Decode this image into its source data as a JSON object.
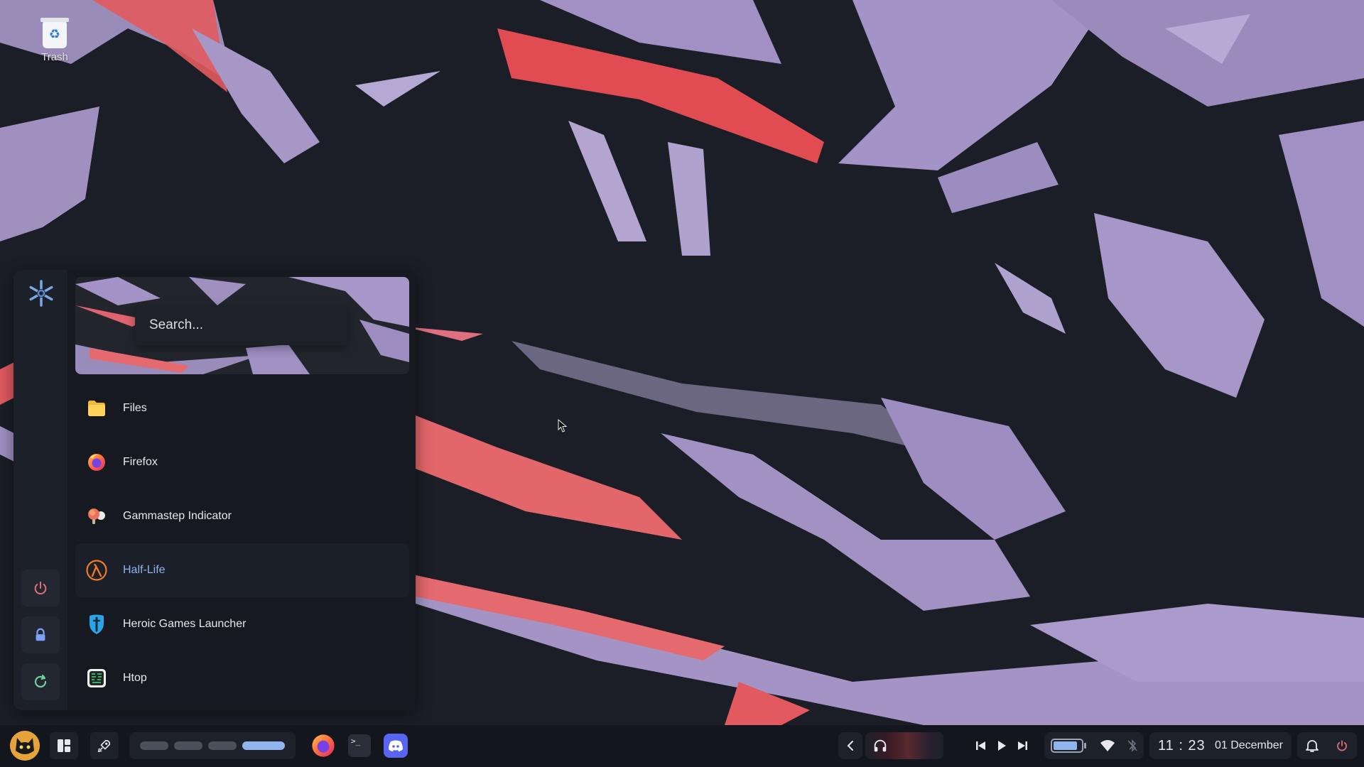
{
  "desktop": {
    "icons": [
      {
        "label": "Trash",
        "icon": "trash-icon"
      }
    ]
  },
  "launcher": {
    "logo": "nixos-snowflake-icon",
    "search": {
      "placeholder": "Search...",
      "value": ""
    },
    "apps": [
      {
        "label": "Files",
        "icon": "files-icon",
        "selected": false
      },
      {
        "label": "Firefox",
        "icon": "firefox-icon",
        "selected": false
      },
      {
        "label": "Gammastep Indicator",
        "icon": "gammastep-icon",
        "selected": false
      },
      {
        "label": "Half-Life",
        "icon": "half-life-icon",
        "selected": true
      },
      {
        "label": "Heroic Games Launcher",
        "icon": "heroic-icon",
        "selected": false
      },
      {
        "label": "Htop",
        "icon": "htop-icon",
        "selected": false
      }
    ],
    "side_buttons": [
      {
        "name": "power",
        "icon": "power-icon"
      },
      {
        "name": "lock",
        "icon": "lock-icon"
      },
      {
        "name": "reboot",
        "icon": "refresh-icon"
      }
    ]
  },
  "taskbar": {
    "workspaces": {
      "count": 4,
      "active": 4
    },
    "apps": [
      {
        "name": "firefox",
        "icon": "firefox-icon"
      },
      {
        "name": "terminal",
        "icon": "terminal-icon"
      },
      {
        "name": "discord",
        "icon": "discord-icon"
      }
    ],
    "media": {
      "state": "paused"
    },
    "battery_level": 0.85,
    "clock": {
      "time": "11 : 23",
      "date": "01 December"
    }
  },
  "colors": {
    "accent": "#8fb4ee",
    "power": "#e06c75",
    "lock": "#7aa2f7",
    "refresh": "#6fd3a0",
    "panel": "#161920"
  }
}
